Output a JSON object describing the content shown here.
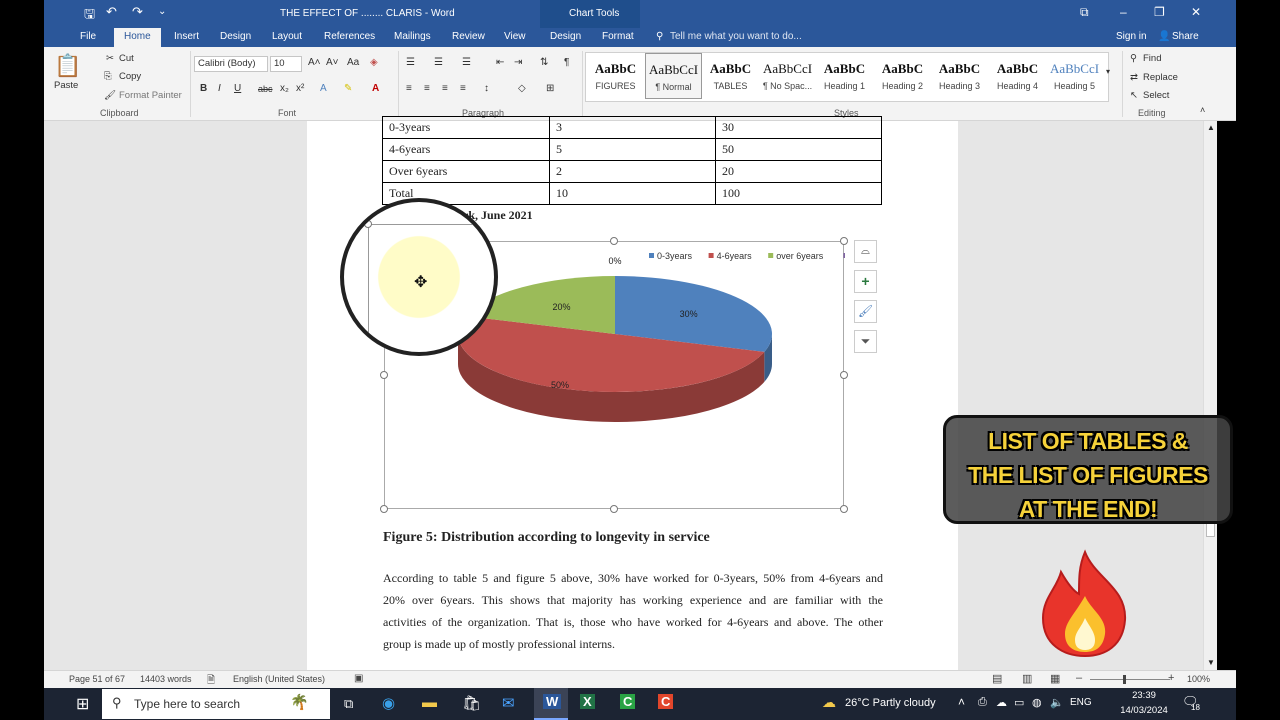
{
  "window": {
    "title": "THE  EFFECT OF ........ CLARIS - Word",
    "chart_tools": "Chart Tools",
    "ctrl_restore": "⧉",
    "ctrl_min": "–",
    "ctrl_max": "❐",
    "ctrl_close": "✕"
  },
  "tabs": {
    "file": "File",
    "home": "Home",
    "insert": "Insert",
    "design": "Design",
    "layout": "Layout",
    "references": "References",
    "mailings": "Mailings",
    "review": "Review",
    "view": "View",
    "chart_design": "Design",
    "chart_format": "Format",
    "tell_me": "Tell me what you want to do...",
    "signin": "Sign in",
    "share": "Share"
  },
  "ribbon": {
    "clipboard": {
      "paste": "Paste",
      "cut": "Cut",
      "copy": "Copy",
      "format_painter": "Format Painter",
      "group": "Clipboard"
    },
    "font": {
      "name": "Calibri (Body)",
      "size": "10",
      "group": "Font"
    },
    "paragraph": {
      "group": "Paragraph"
    },
    "styles": {
      "group": "Styles",
      "items": [
        {
          "sample": "AaBbC",
          "name": "FIGURES"
        },
        {
          "sample": "AaBbCcI",
          "name": "¶ Normal"
        },
        {
          "sample": "AaBbC",
          "name": "TABLES"
        },
        {
          "sample": "AaBbCcI",
          "name": "¶ No Spac..."
        },
        {
          "sample": "AaBbC",
          "name": "Heading 1"
        },
        {
          "sample": "AaBbC",
          "name": "Heading 2"
        },
        {
          "sample": "AaBbC",
          "name": "Heading 3"
        },
        {
          "sample": "AaBbC",
          "name": "Heading 4"
        },
        {
          "sample": "AaBbCcI",
          "name": "Heading 5"
        }
      ]
    },
    "editing": {
      "find": "Find",
      "replace": "Replace",
      "select": "Select",
      "group": "Editing"
    }
  },
  "document": {
    "table_rows": [
      [
        "0-3years",
        "3",
        "30"
      ],
      [
        "4-6years",
        "5",
        "50"
      ],
      [
        "Over 6years",
        "2",
        "20"
      ],
      [
        "Total",
        "10",
        "100"
      ]
    ],
    "source_note": "rk, June 2021",
    "figure_caption": "Figure 5: Distribution according to longevity in service",
    "paragraph": [
      "According to table 5 and figure 5 above, 30% have worked for 0-3years, 50% from 4-6years and",
      "20% over 6years. This shows that majority has working experience and are familiar with the",
      "activities of the organization. That is, those who have worked for 4-6years and above. The other",
      "group is made up of mostly professional interns."
    ]
  },
  "chart_data": {
    "type": "pie",
    "categories": [
      "0-3years",
      "4-6years",
      "over 6years",
      ""
    ],
    "values": [
      30,
      50,
      20,
      0
    ],
    "labels": [
      "30%",
      "50%",
      "20%",
      "0%"
    ],
    "colors": [
      "#4f81bd",
      "#c0504d",
      "#9bbb59",
      "#8064a2"
    ],
    "legend_position": "top-right",
    "style": "3d"
  },
  "status": {
    "page": "Page 51 of 67",
    "words": "14403 words",
    "language": "English (United States)",
    "zoom": "100%"
  },
  "taskbar": {
    "search": "Type here to search",
    "weather": "26°C  Partly cloudy",
    "lang": "ENG",
    "time": "23:39",
    "date": "14/03/2024",
    "notif": "18"
  },
  "overlay": {
    "banner": [
      "LIST OF TABLES &",
      "THE LIST OF FIGURES",
      "AT THE END!"
    ]
  }
}
